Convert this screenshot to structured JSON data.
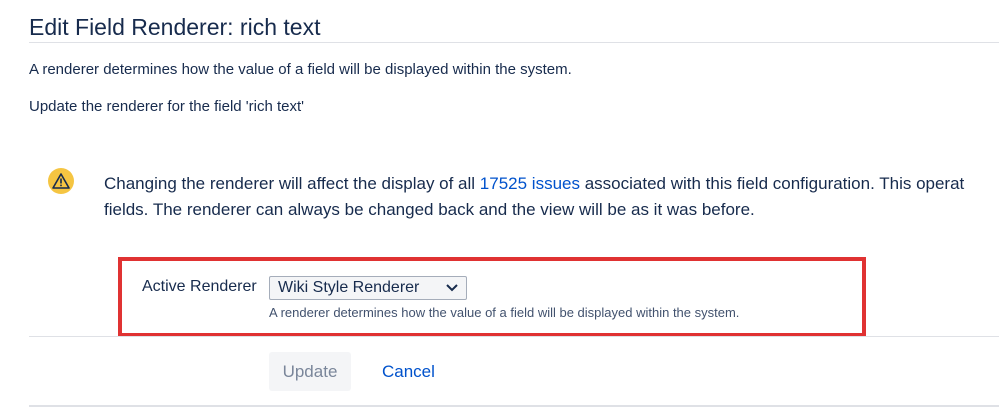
{
  "page": {
    "title": "Edit Field Renderer: rich text",
    "description": "A renderer determines how the value of a field will be displayed within the system.",
    "update_instruction": "Update the renderer for the field 'rich text'"
  },
  "warning": {
    "icon": "warning-icon",
    "text_before": "Changing the renderer will affect the display of all ",
    "issues_link": "17525 issues",
    "text_after": " associated with this field configuration. This operat",
    "line2": "fields. The renderer can always be changed back and the view will be as it was before."
  },
  "form": {
    "active_renderer_label": "Active Renderer",
    "renderer_selected": "Wiki Style Renderer",
    "renderer_help": "A renderer determines how the value of a field will be displayed within the system."
  },
  "actions": {
    "update_label": "Update",
    "cancel_label": "Cancel"
  },
  "colors": {
    "highlight_border": "#e03232",
    "link": "#0052cc",
    "warning": "#f5c542"
  }
}
